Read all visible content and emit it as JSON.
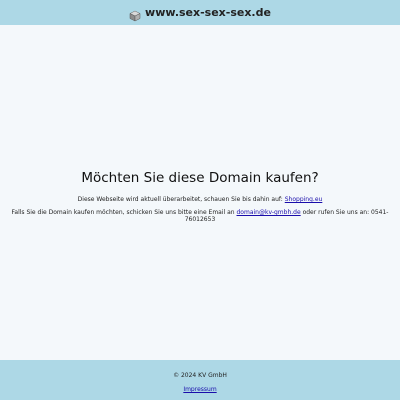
{
  "header": {
    "site_name": "www.sex-sex-sex.de",
    "logo_icon": "cube-icon"
  },
  "main": {
    "headline": "Möchten Sie diese Domain kaufen?",
    "line1_text": "Diese Webseite wird aktuell überarbeitet, schauen Sie bis dahin auf: ",
    "line1_link": "Shopping.eu",
    "line2_text_before": "Falls Sie die Domain kaufen möchten, schicken Sie uns bitte eine Email an ",
    "line2_email": "domain@kv-gmbh.de",
    "line2_text_after": " oder rufen Sie uns an: 0541-76012653"
  },
  "footer": {
    "copyright": "© 2024 KV GmbH",
    "impressum_label": "Impressum"
  },
  "colors": {
    "header_bg": "#add8e6",
    "footer_bg": "#add8e6",
    "page_bg": "#f4f8fb",
    "link": "#1a0dab"
  }
}
